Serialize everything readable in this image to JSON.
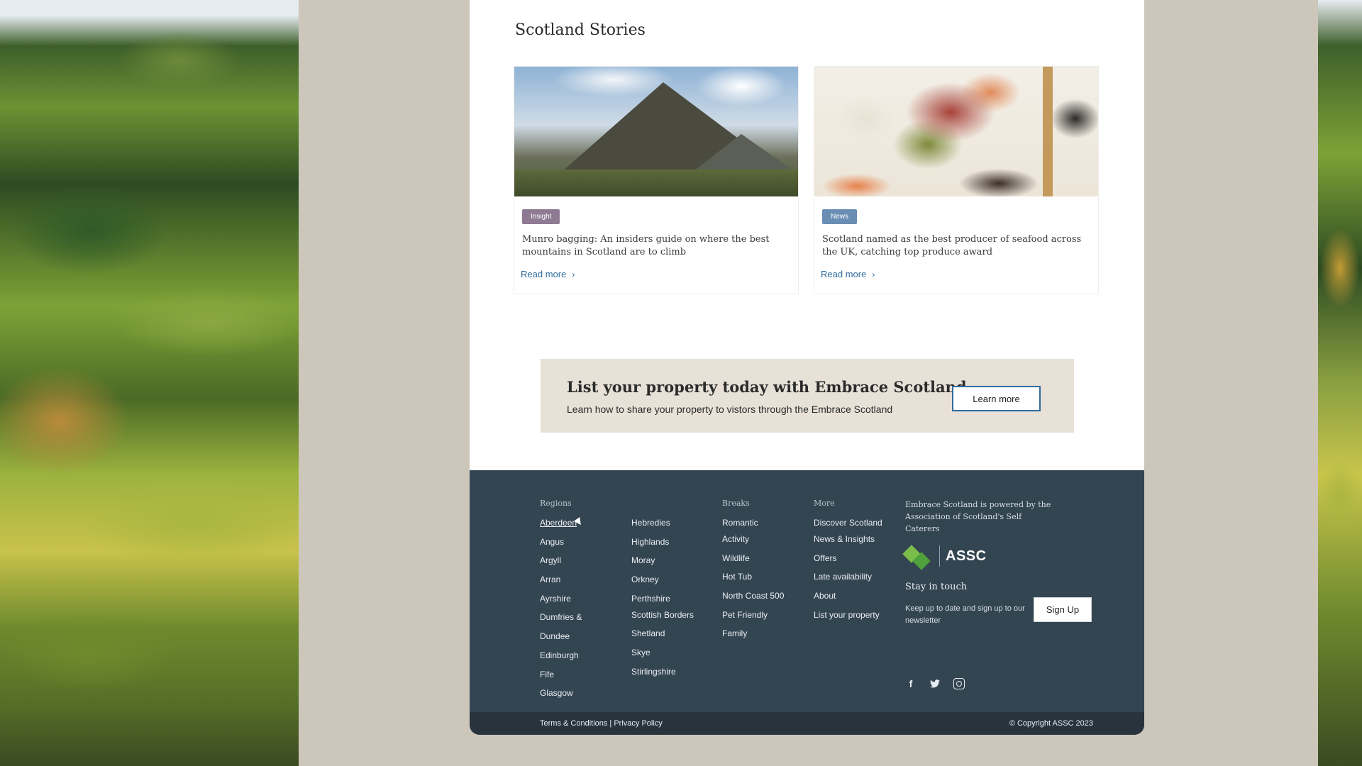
{
  "stories": {
    "title": "Scotland Stories",
    "cards": [
      {
        "tag": "Insight",
        "text": "Munro bagging: An insiders guide on where the best mountains in Scotland are to climb",
        "link": "Read more"
      },
      {
        "tag": "News",
        "text": "Scotland named as the best producer of seafood across the UK, catching top produce award",
        "link": "Read more"
      }
    ]
  },
  "promo": {
    "title": "List your property today with Embrace Scotland",
    "subtitle": "Learn how to share your property to vistors through the Embrace Scotland",
    "button": "Learn more"
  },
  "footer": {
    "regions_heading": "Regions",
    "regions": [
      "Aberdeen",
      "Angus",
      "Argyll",
      "Arran",
      "Ayrshire",
      "Dumfries &",
      "Dundee",
      "Edinburgh",
      "Fife",
      "Glasgow"
    ],
    "regions2": [
      "Hebredies",
      "Highlands",
      "Moray",
      "Orkney",
      "Perthshire",
      "Scottish Borders",
      "Shetland",
      "Skye",
      "Stirlingshire"
    ],
    "breaks_heading": "Breaks",
    "breaks": [
      "Romantic",
      "Activity",
      "Wildlife",
      "Hot Tub",
      "North Coast 500",
      "Pet Friendly",
      "Family"
    ],
    "more_heading": "More",
    "more": [
      "Discover Scotland",
      "News & Insights",
      "Offers",
      "Late availability",
      "About",
      "List your property"
    ],
    "assc_text": "Embrace Scotland is powered by the Association of Scotland's Self Caterers",
    "assc_logo": "ASSC",
    "stay_title": "Stay in touch",
    "stay_text": "Keep up to date and sign up to our newsletter",
    "signup": "Sign Up",
    "social": [
      "facebook-icon",
      "twitter-icon",
      "instagram-icon"
    ],
    "legal": "Terms & Conditions | Privacy Policy",
    "copyright": "© Copyright ASSC 2023"
  },
  "colors": {
    "footer_bg": "#344552",
    "accent": "#2f6c9e",
    "tag_insight": "#8e7a93",
    "tag_news": "#6a8db4"
  }
}
